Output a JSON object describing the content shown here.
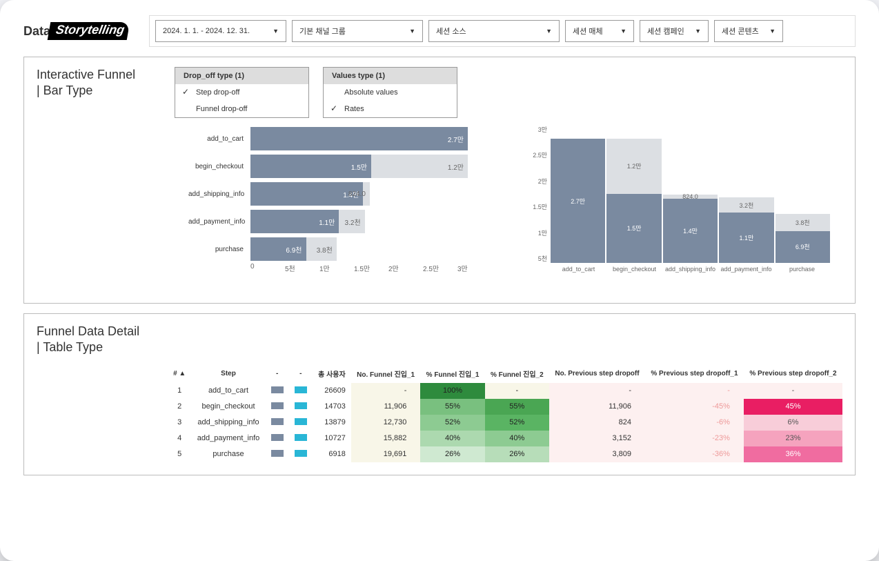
{
  "logo": {
    "part1": "Data",
    "part2": "Storytelling"
  },
  "filters": {
    "daterange": "2024. 1. 1. - 2024. 12. 31.",
    "channel": "기본 채널 그룹",
    "source": "세션 소스",
    "medium": "세션 매체",
    "campaign": "세션 캠페인",
    "content": "세션 콘텐츠"
  },
  "funnel_card": {
    "title1": "Interactive Funnel",
    "title2": "| Bar Type",
    "dropoff_head": "Drop_off type (1)",
    "dropoff_step": "Step drop-off",
    "dropoff_funnel": "Funnel drop-off",
    "values_head": "Values type (1)",
    "values_abs": "Absolute values",
    "values_rates": "Rates"
  },
  "table_card": {
    "title1": "Funnel Data Detail",
    "title2": "| Table Type"
  },
  "axis_h": {
    "t0": "0",
    "t1": "5천",
    "t2": "1만",
    "t3": "1.5만",
    "t4": "2만",
    "t5": "2.5만",
    "t6": "3만"
  },
  "axis_v": {
    "t0": "3만",
    "t1": "2.5만",
    "t2": "2만",
    "t3": "1.5만",
    "t4": "1만",
    "t5": "5천"
  },
  "table_headers": {
    "num": "# ▲",
    "step": "Step",
    "d1": "-",
    "d2": "-",
    "users": "총 사용자",
    "nf1": "No. Funnel 진입_1",
    "pf1": "% Funnel 진입_1",
    "pf2": "% Funnel 진입_2",
    "np": "No. Previous step dropoff",
    "pp1": "% Previous step dropoff_1",
    "pp2": "% Previous step dropoff_2"
  },
  "chart_data": {
    "type": "bar",
    "max": 30000,
    "steps": [
      {
        "name": "add_to_cart",
        "value": 27000,
        "dropoff": null,
        "label": "2.7만",
        "drop_label": ""
      },
      {
        "name": "begin_checkout",
        "value": 15000,
        "dropoff": 12000,
        "label": "1.5만",
        "drop_label": "1.2만"
      },
      {
        "name": "add_shipping_info",
        "value": 14000,
        "dropoff": 824,
        "label": "1.4만",
        "drop_label": "824.0"
      },
      {
        "name": "add_payment_info",
        "value": 11000,
        "dropoff": 3200,
        "label": "1.1만",
        "drop_label": "3.2천"
      },
      {
        "name": "purchase",
        "value": 6900,
        "dropoff": 3800,
        "label": "6.9천",
        "drop_label": "3.8천"
      }
    ],
    "table": [
      {
        "n": "1",
        "step": "add_to_cart",
        "users": "26609",
        "nf1": "-",
        "pf1": "100%",
        "pf2": "-",
        "np": "-",
        "pp1": "-",
        "pp2": "-",
        "g1": "#2e8b3d",
        "g2": "#f8f6e8",
        "p2c": "#fdf0f0",
        "p2t": "#555"
      },
      {
        "n": "2",
        "step": "begin_checkout",
        "users": "14703",
        "nf1": "11,906",
        "pf1": "55%",
        "pf2": "55%",
        "np": "11,906",
        "pp1": "-45%",
        "pp2": "45%",
        "g1": "#79c07f",
        "g2": "#4aa653",
        "p2c": "#e91e63",
        "p2t": "#fff"
      },
      {
        "n": "3",
        "step": "add_shipping_info",
        "users": "13879",
        "nf1": "12,730",
        "pf1": "52%",
        "pf2": "52%",
        "np": "824",
        "pp1": "-6%",
        "pp2": "6%",
        "g1": "#8dcb92",
        "g2": "#5ab463",
        "p2c": "#f8cdd9",
        "p2t": "#555"
      },
      {
        "n": "4",
        "step": "add_payment_info",
        "users": "10727",
        "nf1": "15,882",
        "pf1": "40%",
        "pf2": "40%",
        "np": "3,152",
        "pp1": "-23%",
        "pp2": "23%",
        "g1": "#acd9af",
        "g2": "#8dcb92",
        "p2c": "#f5a3be",
        "p2t": "#555"
      },
      {
        "n": "5",
        "step": "purchase",
        "users": "6918",
        "nf1": "19,691",
        "pf1": "26%",
        "pf2": "26%",
        "np": "3,809",
        "pp1": "-36%",
        "pp2": "36%",
        "g1": "#cfe9d1",
        "g2": "#b7ddb9",
        "p2c": "#f06ca0",
        "p2t": "#fff"
      }
    ]
  }
}
